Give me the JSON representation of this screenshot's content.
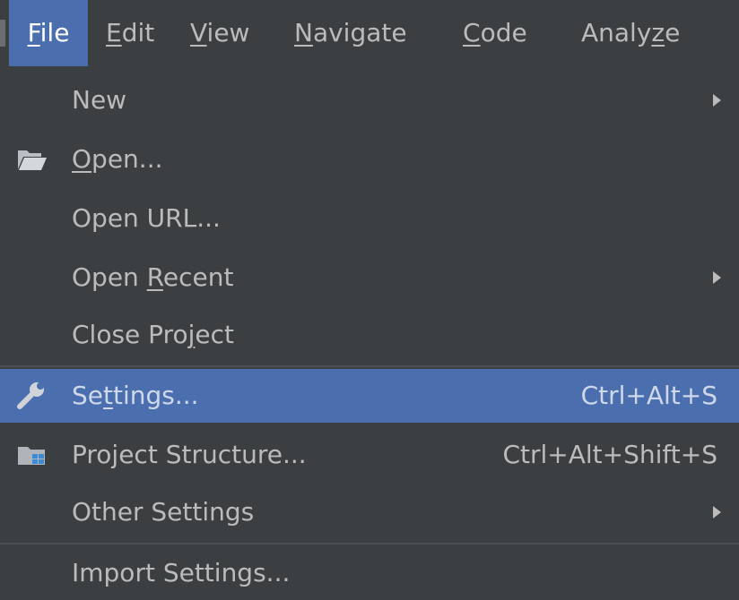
{
  "menubar": {
    "items": [
      {
        "pre": "",
        "ul": "F",
        "post": "ile"
      },
      {
        "pre": "",
        "ul": "E",
        "post": "dit"
      },
      {
        "pre": "",
        "ul": "V",
        "post": "iew"
      },
      {
        "pre": "",
        "ul": "N",
        "post": "avigate"
      },
      {
        "pre": "",
        "ul": "C",
        "post": "ode"
      },
      {
        "pre": "Analy",
        "ul": "z",
        "post": "e"
      }
    ]
  },
  "file_menu": {
    "items": [
      {
        "label": "New"
      },
      {
        "pre": "",
        "ul": "O",
        "post": "pen...",
        "icon": "folder-open-icon"
      },
      {
        "label": "Open URL..."
      },
      {
        "pre": "Open ",
        "ul": "R",
        "post": "ecent"
      },
      {
        "pre": "Close Pro",
        "ul": "j",
        "post": "ect"
      },
      {
        "pre": "Se",
        "ul": "t",
        "post": "tings...",
        "shortcut": "Ctrl+Alt+S",
        "icon": "wrench-icon",
        "selected": true
      },
      {
        "label": "Project Structure...",
        "shortcut": "Ctrl+Alt+Shift+S",
        "icon": "project-structure-icon"
      },
      {
        "label": "Other Settings"
      },
      {
        "label": "Import Settings..."
      }
    ]
  },
  "colors": {
    "background": "#3c3f41",
    "selection": "#4b6eaf",
    "text": "#bbbbbb"
  }
}
